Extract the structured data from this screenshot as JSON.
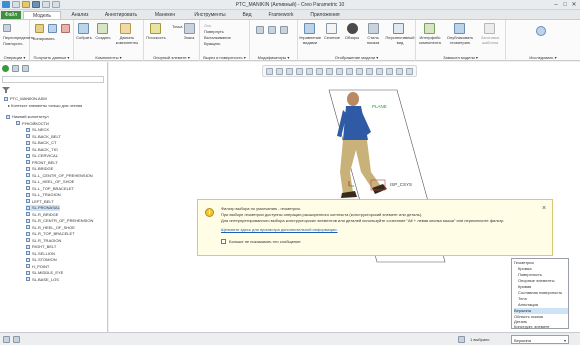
{
  "window": {
    "title": "PTC_MANIKIN (Активный) - Creo Parametric 10",
    "minimize": "–",
    "maximize": "□",
    "close": "✕"
  },
  "ribbon_tabs": [
    "Файл",
    "Модель",
    "Анализ",
    "Аннотировать",
    "Манекен",
    "Инструменты",
    "Вид",
    "Framework",
    "Приложения"
  ],
  "ribbon": {
    "groups": [
      {
        "label": "Операции ▾",
        "items": [
          "Переопределить",
          "Повторить"
        ]
      },
      {
        "label": "Получить данные ▾",
        "items": [
          "Копировать",
          "Вставить",
          "Удалить"
        ]
      },
      {
        "label": "Компоненты ▾",
        "items": [
          "Собрать",
          "Создать",
          "Двигать компоненты"
        ]
      },
      {
        "label": "Опорный элемент ▾",
        "items": [
          "Плоскость",
          "Точка",
          "Эскиз"
        ]
      },
      {
        "label": "Вырез и поверхность ▾",
        "items": [
          "Ось",
          "Повернуть",
          "Выталкивание",
          "Вращать"
        ]
      },
      {
        "label": "Модификаторы ▾",
        "items": []
      },
      {
        "label": "Отображение модели ▾",
        "items": [
          "Управление видами",
          "Сечение",
          "Обзоры",
          "Стиль показа",
          "Перспективный вид"
        ]
      },
      {
        "label": "Замысел модели ▾",
        "items": [
          "Интерфейс компонента",
          "Опубликовать геометрию",
          "Заготовка шаблона"
        ]
      },
      {
        "label": "Исследовать ▾",
        "items": []
      }
    ]
  },
  "left_panel": {
    "model": "PTC_MANIKIN.ASM",
    "filter_label": "Контекст элементы только для чтения",
    "tree": [
      {
        "label": "Нижний колонтитул",
        "level": 0
      },
      {
        "label": "РУКОЙКОСТИ",
        "level": 1
      },
      {
        "label": "SL.NECK",
        "level": 2
      },
      {
        "label": "SL.BACK_BELT",
        "level": 2
      },
      {
        "label": "SL.BACK_CT",
        "level": 2
      },
      {
        "label": "SL.BACK_TIO",
        "level": 2
      },
      {
        "label": "SL.CERVICAL",
        "level": 2
      },
      {
        "label": "FRONT_BELT",
        "level": 2
      },
      {
        "label": "SL.BRIDGE",
        "level": 2
      },
      {
        "label": "SL.L_CENTR_OF_PREHENSION",
        "level": 2
      },
      {
        "label": "SL.L_HEEL_OF_SHOE",
        "level": 2
      },
      {
        "label": "SL.L_TOP_BRACELET",
        "level": 2
      },
      {
        "label": "SL.L_TRAGION",
        "level": 2
      },
      {
        "label": "LEFT_BELT",
        "level": 2
      },
      {
        "label": "SL.PRONASAL",
        "level": 2,
        "selected": true
      },
      {
        "label": "SL.R_BRIDGE",
        "level": 2
      },
      {
        "label": "SL.R_CENTR_OF_PREHENSION",
        "level": 2
      },
      {
        "label": "SL.R_HEEL_OF_SHOE",
        "level": 2
      },
      {
        "label": "SL.R_TOP_BRACELET",
        "level": 2
      },
      {
        "label": "SL.R_TRAGION",
        "level": 2
      },
      {
        "label": "RIGHT_BELT",
        "level": 2
      },
      {
        "label": "SL.SELLION",
        "level": 2
      },
      {
        "label": "SL.STOMION",
        "level": 2
      },
      {
        "label": "H_POINT",
        "level": 2
      },
      {
        "label": "SL.MIDDLE_EYE",
        "level": 2
      },
      {
        "label": "SL.BASE_LOS",
        "level": 2
      }
    ]
  },
  "graphics": {
    "labels": [
      "PLANE",
      "ISP_CSYS"
    ]
  },
  "popup": {
    "title": "Фильтр выбора по умолчанию - геометрия.",
    "line1": "При выборе геометрии доступны операции расширенного контекста (конструкторский элемент или деталь).",
    "line2": "Для интерпретированного выбора конструкторских элементов или деталей используйте сочетание \"Alt + левая кнопка мыши\" или переключите фильтр.",
    "link": "Щелкните здесь для просмотра дополнительной информации.",
    "checkbox": "Больше не показывать это сообщение",
    "close": "×"
  },
  "dropdown": {
    "options": [
      "Геометрия",
      "Кромка",
      "Поверхность",
      "Опорные элементы",
      "Кривая",
      "Составная поверхность",
      "Тело",
      "Аннотация",
      "Вершина",
      "Область эскиза",
      "Деталь",
      "Конструкт. элемент"
    ],
    "selected": "Вершина"
  },
  "status": {
    "selected_count": "1 выбрано",
    "filter_value": "Вершина"
  },
  "colors": {
    "file_tab": "#3e8f3e",
    "popup_bg": "#fffde6",
    "selection": "#cfe3f7"
  }
}
